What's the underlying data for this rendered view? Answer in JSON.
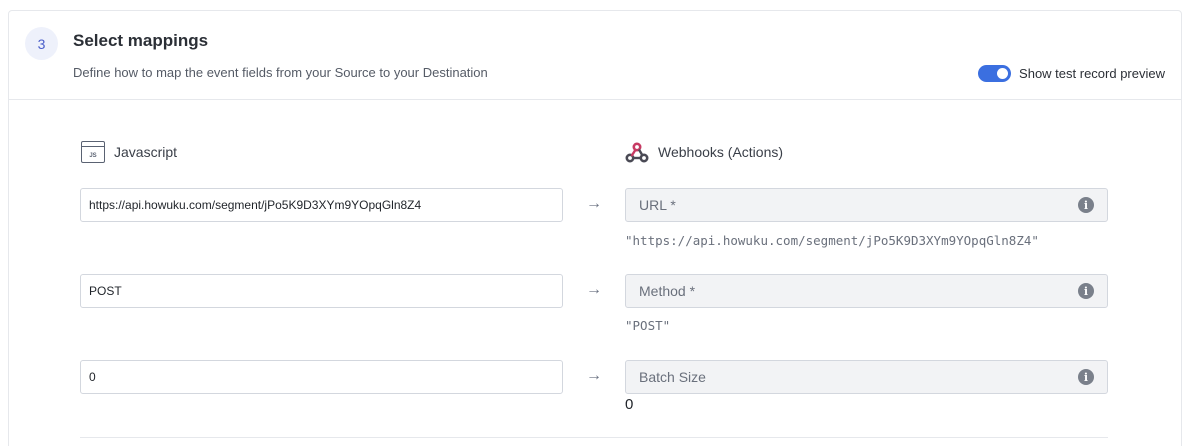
{
  "step": {
    "number": "3",
    "title": "Select mappings",
    "description": "Define how to map the event fields from your Source to your Destination"
  },
  "toggle": {
    "label": "Show test record preview",
    "checked": true,
    "color": "#3b6fe0"
  },
  "source": {
    "name": "Javascript",
    "icon": "javascript-icon",
    "icon_text": "JS"
  },
  "destination": {
    "name": "Webhooks (Actions)",
    "icon": "webhooks-icon"
  },
  "mappings": [
    {
      "source_value": "https://api.howuku.com/segment/jPo5K9D3XYm9YOpqGln8Z4",
      "field_label": "URL *",
      "preview": "\"https://api.howuku.com/segment/jPo5K9D3XYm9YOpqGln8Z4\""
    },
    {
      "source_value": "POST",
      "field_label": "Method *",
      "preview": "\"POST\""
    },
    {
      "source_value": "0",
      "field_label": "Batch Size",
      "preview": "0"
    }
  ],
  "arrow_glyph": "→",
  "info_glyph": "i"
}
